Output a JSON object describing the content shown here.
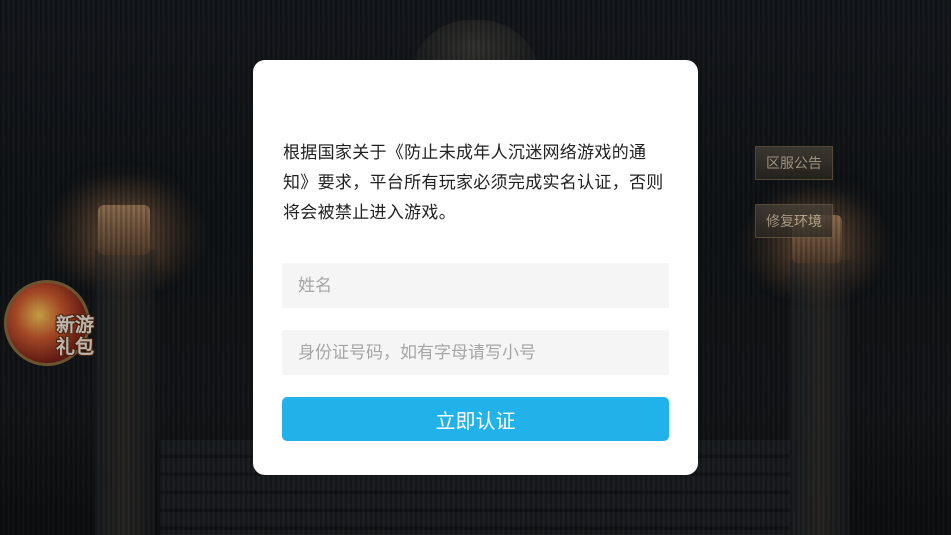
{
  "background": {
    "side_buttons": {
      "server_notice": "区服公告",
      "repair_env": "修复环境"
    },
    "gift_badge": {
      "label": "新游\n礼包",
      "icon": "gift-pack-icon"
    }
  },
  "dialog": {
    "notice_text": "根据国家关于《防止未成年人沉迷网络游戏的通知》要求，平台所有玩家必须完成实名认证，否则将会被禁止进入游戏。",
    "name_field": {
      "value": "",
      "placeholder": "姓名"
    },
    "id_field": {
      "value": "",
      "placeholder": "身份证号码，如有字母请写小号"
    },
    "submit_label": "立即认证"
  },
  "colors": {
    "accent": "#22b2ea",
    "dialog_bg": "#ffffff",
    "input_bg": "#f5f5f5"
  }
}
